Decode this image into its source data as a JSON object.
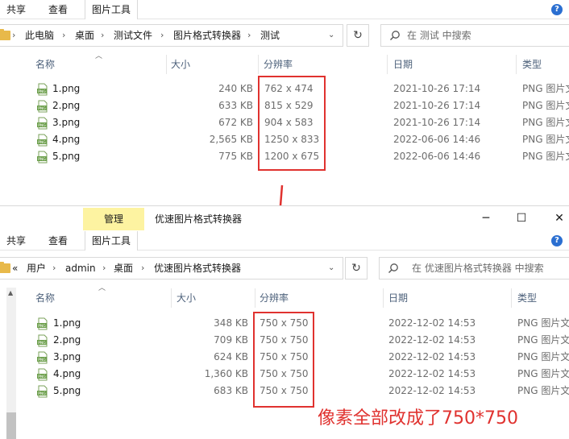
{
  "top_window": {
    "ribbon": {
      "share": "共享",
      "view": "查看",
      "picture_tools": "图片工具"
    },
    "breadcrumb": [
      "此电脑",
      "桌面",
      "测试文件",
      "图片格式转换器",
      "测试"
    ],
    "search_placeholder": "在 测试 中搜索",
    "columns": {
      "name": "名称",
      "size": "大小",
      "resolution": "分辨率",
      "date": "日期",
      "type": "类型"
    },
    "files": [
      {
        "name": "1.png",
        "size": "240 KB",
        "resolution": "762 x 474",
        "date": "2021-10-26 17:14",
        "type": "PNG 图片文"
      },
      {
        "name": "2.png",
        "size": "633 KB",
        "resolution": "815 x 529",
        "date": "2021-10-26 17:14",
        "type": "PNG 图片文"
      },
      {
        "name": "3.png",
        "size": "672 KB",
        "resolution": "904 x 583",
        "date": "2021-10-26 17:14",
        "type": "PNG 图片文"
      },
      {
        "name": "4.png",
        "size": "2,565 KB",
        "resolution": "1250 x 833",
        "date": "2022-06-06 14:46",
        "type": "PNG 图片文"
      },
      {
        "name": "5.png",
        "size": "775 KB",
        "resolution": "1200 x 675",
        "date": "2022-06-06 14:46",
        "type": "PNG 图片文"
      }
    ]
  },
  "bottom_window": {
    "manage_tab": "管理",
    "title": "优速图片格式转换器",
    "ribbon": {
      "share": "共享",
      "view": "查看",
      "picture_tools": "图片工具"
    },
    "breadcrumb_prefix": "«",
    "breadcrumb": [
      "用户",
      "admin",
      "桌面",
      "优速图片格式转换器"
    ],
    "search_placeholder": "在 优速图片格式转换器 中搜索",
    "columns": {
      "name": "名称",
      "size": "大小",
      "resolution": "分辨率",
      "date": "日期",
      "type": "类型"
    },
    "files": [
      {
        "name": "1.png",
        "size": "348 KB",
        "resolution": "750 x 750",
        "date": "2022-12-02 14:53",
        "type": "PNG 图片文"
      },
      {
        "name": "2.png",
        "size": "709 KB",
        "resolution": "750 x 750",
        "date": "2022-12-02 14:53",
        "type": "PNG 图片文"
      },
      {
        "name": "3.png",
        "size": "624 KB",
        "resolution": "750 x 750",
        "date": "2022-12-02 14:53",
        "type": "PNG 图片文"
      },
      {
        "name": "4.png",
        "size": "1,360 KB",
        "resolution": "750 x 750",
        "date": "2022-12-02 14:53",
        "type": "PNG 图片文"
      },
      {
        "name": "5.png",
        "size": "683 KB",
        "resolution": "750 x 750",
        "date": "2022-12-02 14:53",
        "type": "PNG 图片文"
      }
    ]
  },
  "annotation": {
    "text": "像素全部改成了750*750",
    "color": "#e0322f"
  },
  "colors": {
    "accent_red": "#e0322f",
    "manage_tab_bg": "#fdf3a1",
    "folder": "#e8b94a",
    "header_text": "#4c607a"
  }
}
